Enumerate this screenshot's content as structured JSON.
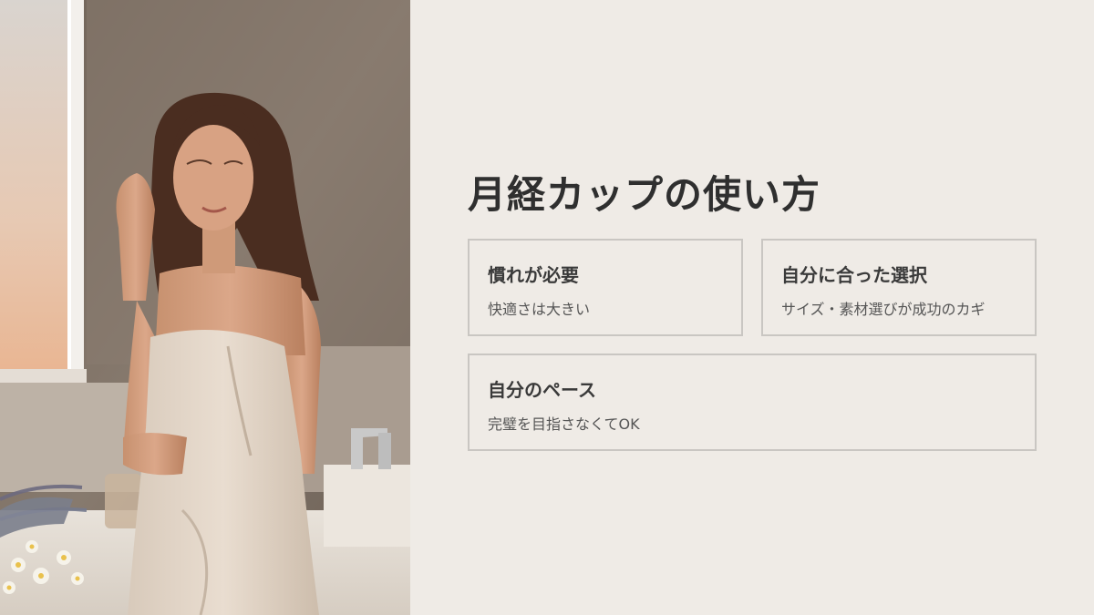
{
  "slide": {
    "title": "月経カップの使い方",
    "cards": [
      {
        "title": "慣れが必要",
        "description": "快適さは大きい"
      },
      {
        "title": "自分に合った選択",
        "description": "サイズ・素材選びが成功のカギ"
      },
      {
        "title": "自分のペース",
        "description": "完璧を目指さなくてOK"
      }
    ]
  },
  "colors": {
    "background": "#efebe6",
    "card_border": "#c9c6c2",
    "title_text": "#2f2f2f",
    "body_text": "#555555"
  }
}
